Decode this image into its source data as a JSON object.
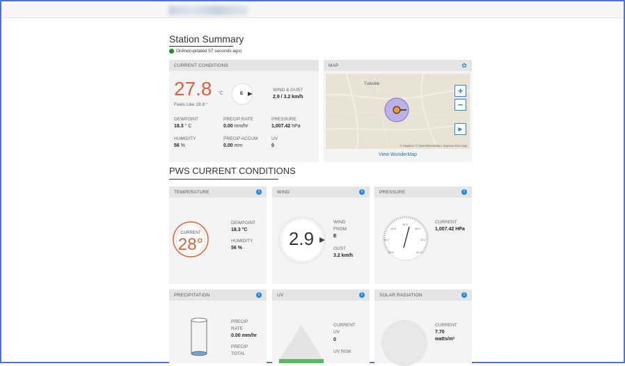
{
  "summary": {
    "title": "Station Summary",
    "status": "Online(updated 57 seconds ago)"
  },
  "current": {
    "header": "CURRENT CONDITIONS",
    "temp": "27.8",
    "temp_unit": "°C",
    "feels_like": "Feels Like 28.8 °",
    "wind_dir": "E",
    "wind_label": "WIND & GUST",
    "wind_value": "2.9  / 3.2 km/h",
    "dewpoint_label": "DEWPOINT",
    "dewpoint_value": "18.3",
    "dewpoint_unit": "° C",
    "precip_rate_label": "PRECIP RATE",
    "precip_rate_value": "0.00",
    "precip_rate_unit": "mm/hr",
    "pressure_label": "PRESSURE",
    "pressure_value": "1,007.42",
    "pressure_unit": "hPa",
    "humidity_label": "HUMIDITY",
    "humidity_value": "56",
    "humidity_unit": "%",
    "precip_accum_label": "PRECIP ACCUM",
    "precip_accum_value": "0.00",
    "precip_accum_unit": "mm",
    "uv_label": "UV",
    "uv_value": "0"
  },
  "map": {
    "header": "MAP",
    "place": "Turkville",
    "attribution": "© Mapbox © OpenStreetMap | Improve this map",
    "link": "View WunderMap",
    "zoom_in": "+",
    "zoom_out": "−",
    "play": "▶"
  },
  "pws": {
    "title": "PWS CURRENT CONDITIONS",
    "temperature": {
      "header": "TEMPERATURE",
      "gauge_label": "CURRENT",
      "gauge_value": "28°",
      "dewpoint_label": "DEWPOINT",
      "dewpoint_value": "18.3 °C",
      "humidity_label": "HUMIDITY",
      "humidity_value": "56 %"
    },
    "wind": {
      "header": "WIND",
      "value": "2.9",
      "from_label_1": "WIND",
      "from_label_2": "FROM",
      "from_value": "E",
      "gust_label": "GUST",
      "gust_value": "3.2 km/h"
    },
    "pressure": {
      "header": "PRESSURE",
      "current_label": "CURRENT",
      "current_value": "1,007.42 HPa",
      "dial_top": "29.9",
      "dial_left": "29.8",
      "dial_right": "30.0",
      "dial_far_left": "29.7",
      "dial_far_right": "30.1",
      "dial_bottom_left": "29.6",
      "dial_bottom_right": "30.2"
    },
    "precipitation": {
      "header": "PRECIPITATION",
      "rate_label_1": "PRECIP",
      "rate_label_2": "RATE",
      "rate_value": "0.00 mm/hr",
      "total_label_1": "PRECIP",
      "total_label_2": "TOTAL"
    },
    "uv": {
      "header": "UV",
      "current_label_1": "CURRENT",
      "current_label_2": "UV",
      "current_value": "0",
      "risk_label": "UV RISK"
    },
    "solar": {
      "header": "SOLAR RADIATION",
      "current_label": "CURRENT",
      "current_value": "7.70",
      "unit": "watts/m²"
    }
  },
  "colors": {
    "accent_blue": "#1e88e5",
    "temp_red": "#e0603d",
    "online_green": "#1e8f2e"
  }
}
